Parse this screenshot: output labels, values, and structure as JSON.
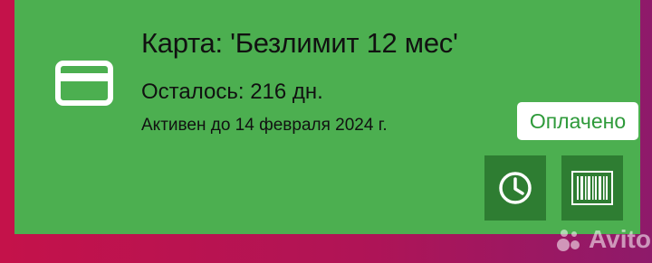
{
  "card": {
    "title": "Карта: 'Безлимит 12 мес'",
    "remaining": "Осталось: 216 дн.",
    "active_until": "Активен до 14 февраля 2024 г.",
    "status": "Оплачено",
    "icon": "credit-card-icon"
  },
  "actions": [
    {
      "icon": "clock-icon"
    },
    {
      "icon": "barcode-icon"
    }
  ],
  "watermark": {
    "text": "Avito"
  },
  "colors": {
    "card_background": "#4caf50",
    "action_button": "#2e7d32",
    "status_text": "#2e9a3a",
    "page_background": "#b01456"
  }
}
